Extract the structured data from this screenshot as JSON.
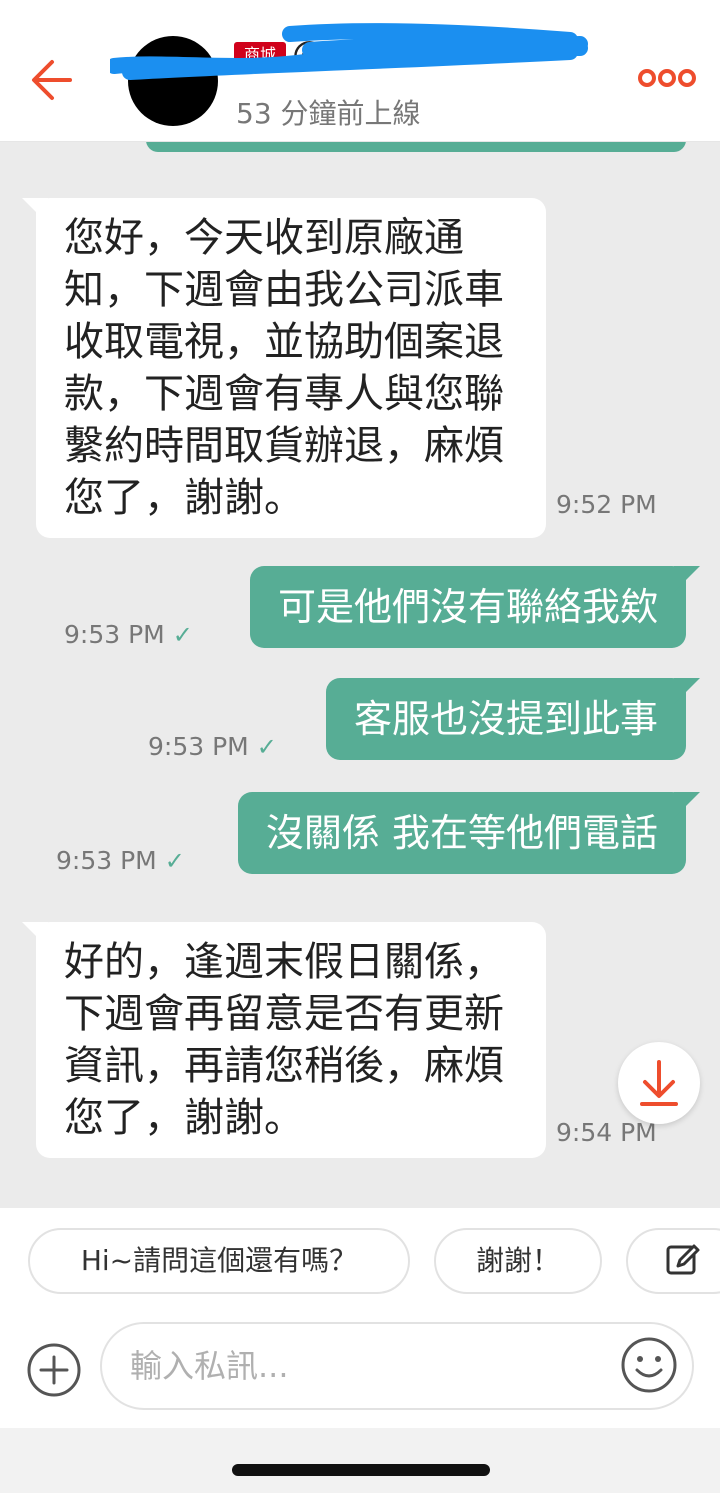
{
  "header": {
    "back_icon": "back-arrow-icon",
    "shop_badge": "商城",
    "shop_name_prefix": "@",
    "status": "53 分鐘前上線",
    "more_icon": "more-dots-icon",
    "accent_color": "#ee4d2d"
  },
  "messages": [
    {
      "direction": "in",
      "text": "您好，今天收到原廠通知，下週會由我公司派車收取電視，並協助個案退款，下週會有專人與您聯繫約時間取貨辦退，麻煩您了，謝謝。",
      "time": "9:52 PM"
    },
    {
      "direction": "out",
      "text": "可是他們沒有聯絡我欸",
      "time": "9:53 PM",
      "status": "✓"
    },
    {
      "direction": "out",
      "text": "客服也沒提到此事",
      "time": "9:53 PM",
      "status": "✓"
    },
    {
      "direction": "out",
      "text": "沒關係 我在等他們電話",
      "time": "9:53 PM",
      "status": "✓"
    },
    {
      "direction": "in",
      "text": "好的，逢週末假日關係，下週會再留意是否有更新資訊，再請您稍後，麻煩您了，謝謝。",
      "time": "9:54 PM"
    }
  ],
  "quick_replies": [
    "Hi~請問這個還有嗎？",
    "謝謝！"
  ],
  "quick_edit_icon": "edit-icon",
  "input": {
    "placeholder": "輸入私訊...",
    "plus_icon": "plus-circle-icon",
    "emoji_icon": "emoji-icon"
  },
  "scroll_icon": "scroll-down-arrow-icon",
  "colors": {
    "bubble_out": "#57ad95",
    "bubble_in": "#ffffff",
    "chat_bg": "#ebebeb"
  }
}
